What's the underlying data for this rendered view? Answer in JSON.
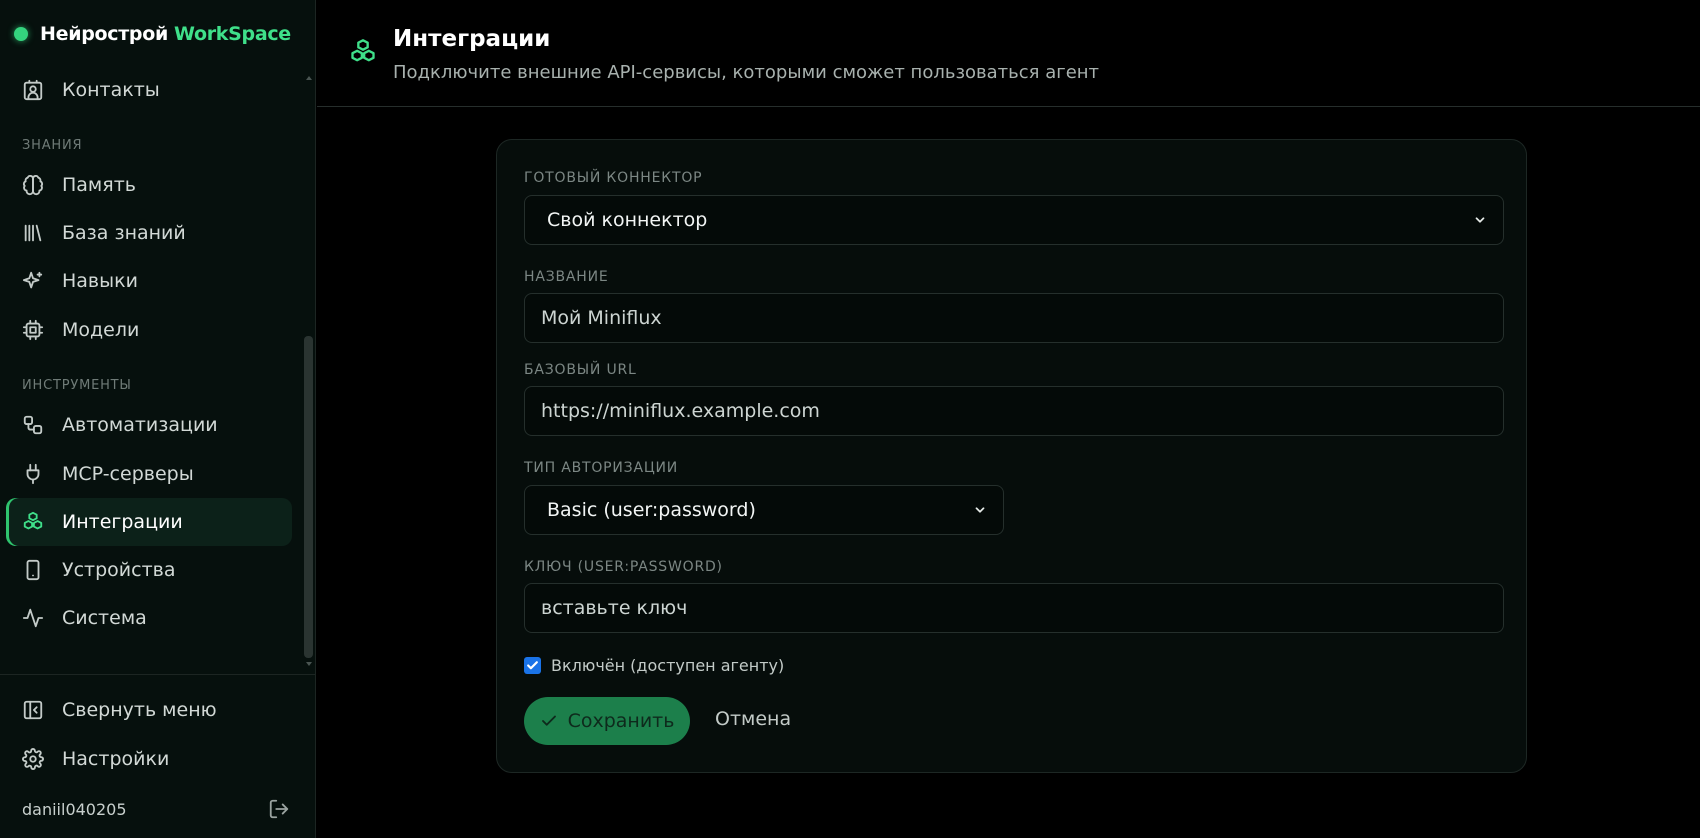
{
  "brand": {
    "name": "Нейрострой",
    "accent": "WorkSpace",
    "accent_color": "#3fe08a"
  },
  "sidebar": {
    "sections": {
      "knowledge": "ЗНАНИЯ",
      "tools": "ИНСТРУМЕНТЫ"
    },
    "items": [
      {
        "label": "Контакты",
        "icon": "contact-icon"
      },
      {
        "label": "Память",
        "icon": "brain-icon"
      },
      {
        "label": "База знаний",
        "icon": "library-icon"
      },
      {
        "label": "Навыки",
        "icon": "sparkles-icon"
      },
      {
        "label": "Модели",
        "icon": "cpu-icon"
      },
      {
        "label": "Автоматизации",
        "icon": "workflow-icon"
      },
      {
        "label": "MCP-серверы",
        "icon": "plug-icon"
      },
      {
        "label": "Интеграции",
        "icon": "boxes-icon",
        "active": true
      },
      {
        "label": "Устройства",
        "icon": "smartphone-icon"
      },
      {
        "label": "Система",
        "icon": "activity-icon"
      }
    ],
    "bottom": {
      "collapse": "Свернуть меню",
      "settings": "Настройки"
    },
    "user": {
      "name": "daniil040205"
    }
  },
  "header": {
    "title": "Интеграции",
    "subtitle": "Подключите внешние API-сервисы, которыми сможет пользоваться агент"
  },
  "form": {
    "connector": {
      "label": "ГОТОВЫЙ КОННЕКТОР",
      "value": "Свой коннектор"
    },
    "name": {
      "label": "НАЗВАНИЕ",
      "placeholder": "Мой Miniflux"
    },
    "base_url": {
      "label": "БАЗОВЫЙ URL",
      "placeholder": "https://miniflux.example.com"
    },
    "auth_type": {
      "label": "ТИП АВТОРИЗАЦИИ",
      "value": "Basic (user:password)"
    },
    "key": {
      "label": "КЛЮЧ (USER:PASSWORD)",
      "placeholder": "вставьте ключ"
    },
    "enabled": {
      "label": "Включён (доступен агенту)",
      "checked": true
    },
    "save_label": "Сохранить",
    "cancel_label": "Отмена"
  },
  "colors": {
    "accent": "#3fe08a",
    "save_button": "#1c7f4b",
    "checkbox": "#1a73e8"
  }
}
